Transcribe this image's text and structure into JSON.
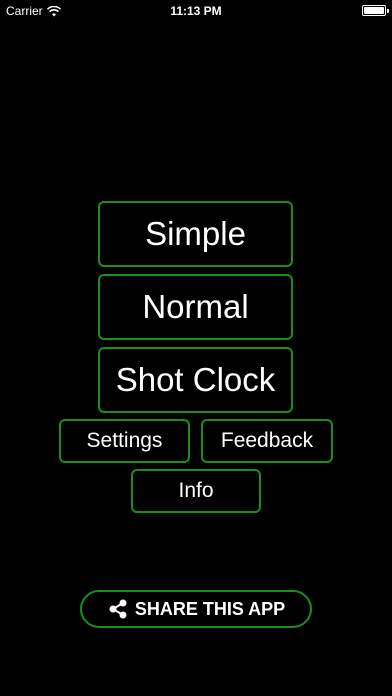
{
  "status_bar": {
    "carrier": "Carrier",
    "time": "11:13 PM"
  },
  "menu": {
    "simple_label": "Simple",
    "normal_label": "Normal",
    "shot_clock_label": "Shot Clock",
    "settings_label": "Settings",
    "feedback_label": "Feedback",
    "info_label": "Info"
  },
  "share": {
    "label": "SHARE THIS APP",
    "icon": "share-icon"
  },
  "colors": {
    "background": "#000000",
    "accent_border": "#1a8f1a",
    "text": "#ffffff"
  }
}
